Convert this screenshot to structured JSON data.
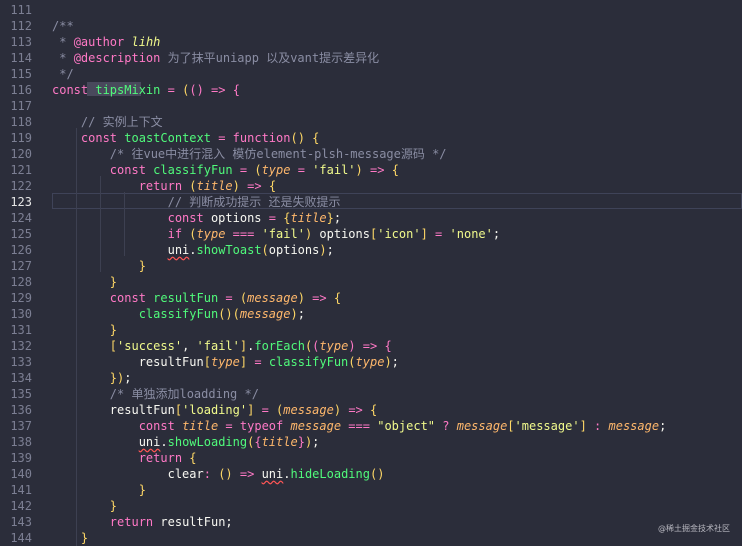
{
  "editor": {
    "active_line": "123",
    "lines": [
      {
        "n": "111",
        "t": ""
      },
      {
        "n": "112",
        "t": "/**"
      },
      {
        "n": "113",
        "t": " * @author lihh"
      },
      {
        "n": "114",
        "t": " * @description 为了抹平uniapp 以及vant提示差异化"
      },
      {
        "n": "115",
        "t": " */"
      },
      {
        "n": "116",
        "t": "const tipsMixin = (() => {"
      },
      {
        "n": "117",
        "t": ""
      },
      {
        "n": "118",
        "t": "    // 实例上下文"
      },
      {
        "n": "119",
        "t": "    const toastContext = function() {"
      },
      {
        "n": "120",
        "t": "        /* 往vue中进行混入 模仿element-plsh-message源码 */"
      },
      {
        "n": "121",
        "t": "        const classifyFun = (type = 'fail') => {"
      },
      {
        "n": "122",
        "t": "            return (title) => {"
      },
      {
        "n": "123",
        "t": "                // 判断成功提示 还是失败提示"
      },
      {
        "n": "124",
        "t": "                const options = {title};"
      },
      {
        "n": "125",
        "t": "                if (type === 'fail') options['icon'] = 'none';"
      },
      {
        "n": "126",
        "t": "                uni.showToast(options);"
      },
      {
        "n": "127",
        "t": "            }"
      },
      {
        "n": "128",
        "t": "        }"
      },
      {
        "n": "129",
        "t": "        const resultFun = (message) => {"
      },
      {
        "n": "130",
        "t": "            classifyFun()(message);"
      },
      {
        "n": "131",
        "t": "        }"
      },
      {
        "n": "132",
        "t": "        ['success', 'fail'].forEach((type) => {"
      },
      {
        "n": "133",
        "t": "            resultFun[type] = classifyFun(type);"
      },
      {
        "n": "134",
        "t": "        });"
      },
      {
        "n": "135",
        "t": "        /* 单独添加loadding */"
      },
      {
        "n": "136",
        "t": "        resultFun['loading'] = (message) => {"
      },
      {
        "n": "137",
        "t": "            const title = typeof message === \"object\" ? message['message'] : message;"
      },
      {
        "n": "138",
        "t": "            uni.showLoading({title});"
      },
      {
        "n": "139",
        "t": "            return {"
      },
      {
        "n": "140",
        "t": "                clear: () => uni.hideLoading()"
      },
      {
        "n": "141",
        "t": "            }"
      },
      {
        "n": "142",
        "t": "        }"
      },
      {
        "n": "143",
        "t": "        return resultFun;"
      },
      {
        "n": "144",
        "t": "    }"
      }
    ]
  },
  "watermark": "@稀土掘金技术社区",
  "colors": {
    "background": "#2b2d3a",
    "keyword": "#ff79c6",
    "function": "#50fa7b",
    "string": "#f1fa8c",
    "parameter": "#ffb86c",
    "comment": "#8a8da3"
  }
}
